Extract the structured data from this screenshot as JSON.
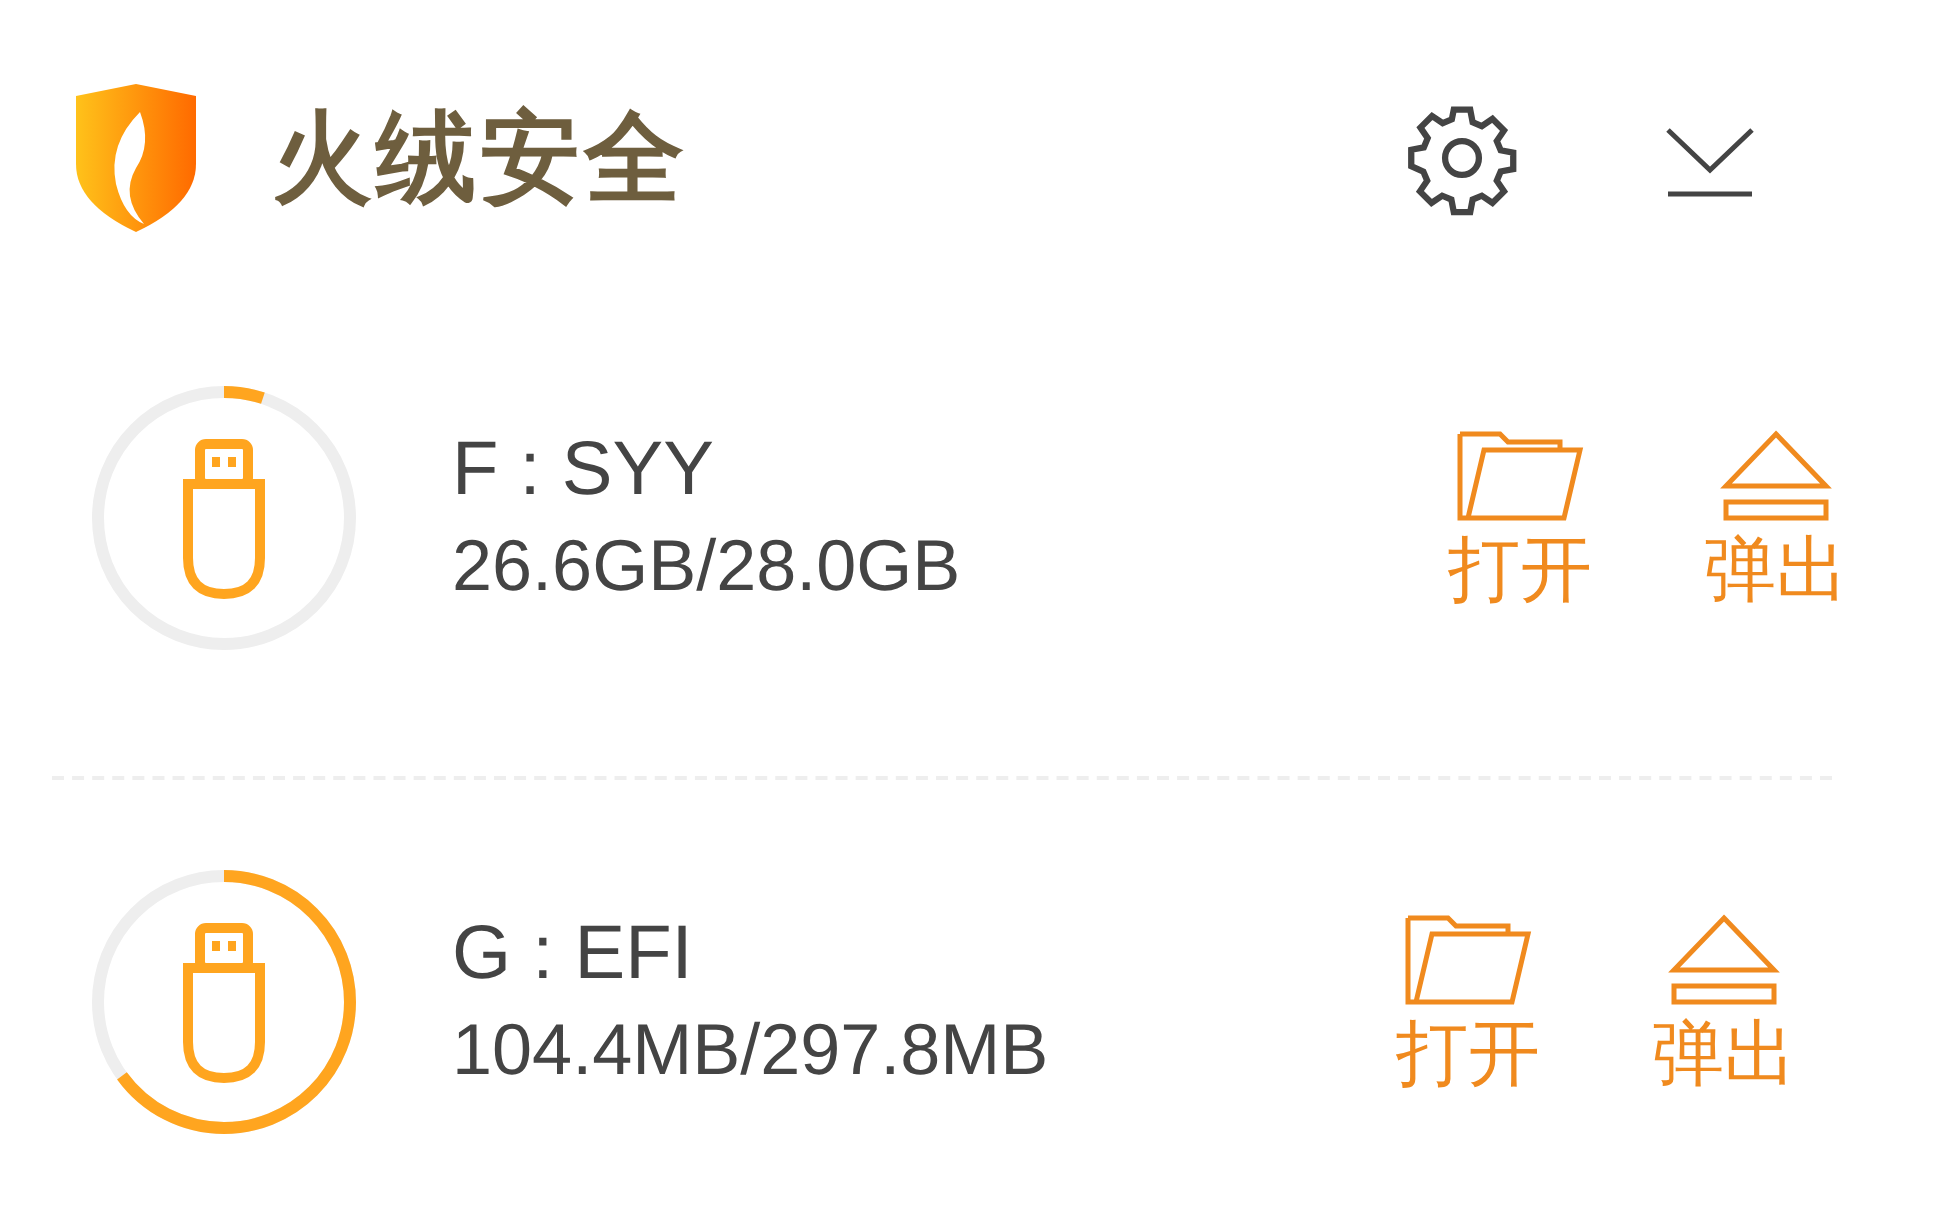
{
  "app": {
    "title": "火绒安全"
  },
  "drives": [
    {
      "name": "F : SYY",
      "size": "26.6GB/28.0GB",
      "open_label": "打开",
      "eject_label": "弹出"
    },
    {
      "name": "G : EFI",
      "size": "104.4MB/297.8MB",
      "open_label": "打开",
      "eject_label": "弹出"
    }
  ]
}
